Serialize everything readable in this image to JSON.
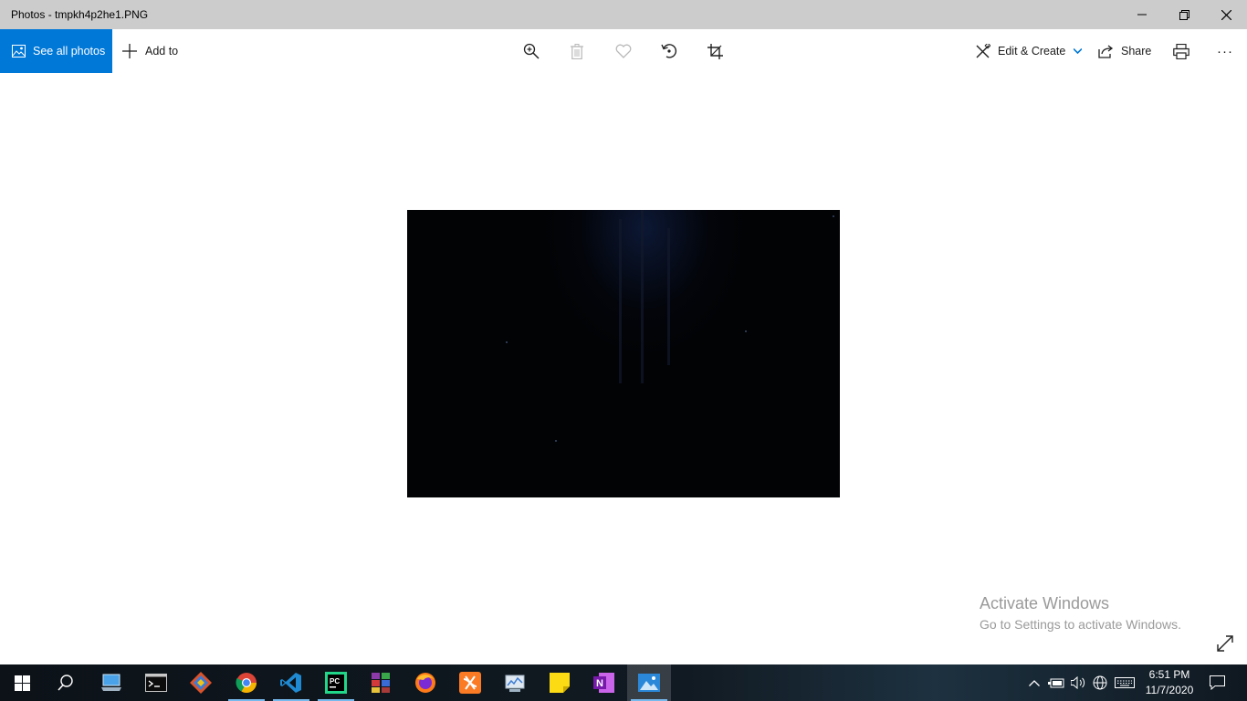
{
  "window": {
    "title": "Photos - tmpkh4p2he1.PNG"
  },
  "toolbar": {
    "see_all_photos": "See all photos",
    "add_to": "Add to",
    "icons": [
      "zoom-in-icon",
      "delete-icon",
      "favorite-icon",
      "rotate-icon",
      "crop-icon"
    ],
    "edit_create": "Edit & Create",
    "share": "Share",
    "more": "···"
  },
  "watermark": {
    "line1": "Activate Windows",
    "line2": "Go to Settings to activate Windows."
  },
  "taskbar": {
    "apps": [
      "start",
      "search",
      "this-pc",
      "command-prompt",
      "git-gui",
      "chrome",
      "vs-code",
      "pycharm",
      "winrar",
      "firefox",
      "xampp",
      "control-panel",
      "sticky-notes",
      "onenote",
      "photos"
    ],
    "clock": {
      "time": "6:51 PM",
      "date": "11/7/2020"
    }
  },
  "colors": {
    "accent": "#0078d7",
    "titlebar": "#cccccc",
    "taskbar": "#101820"
  }
}
